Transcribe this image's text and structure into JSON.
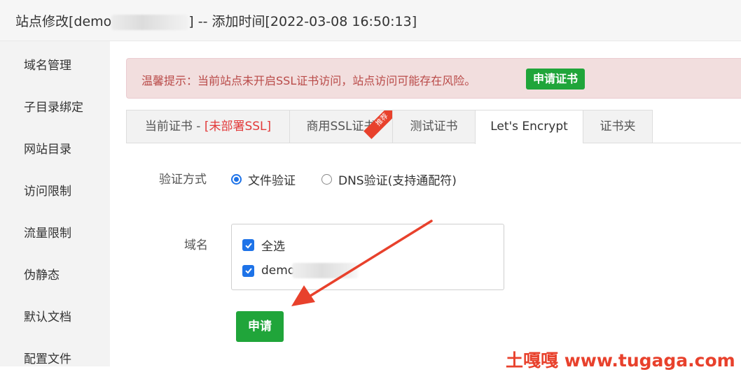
{
  "window": {
    "title_prefix": "站点修改[demo",
    "title_suffix": "] -- 添加时间[2022-03-08 16:50:13]"
  },
  "sidebar": {
    "items": [
      {
        "label": "域名管理"
      },
      {
        "label": "子目录绑定"
      },
      {
        "label": "网站目录"
      },
      {
        "label": "访问限制"
      },
      {
        "label": "流量限制"
      },
      {
        "label": "伪静态"
      },
      {
        "label": "默认文档"
      },
      {
        "label": "配置文件"
      }
    ]
  },
  "alert": {
    "message": "温馨提示：当前站点未开启SSL证书访问，站点访问可能存在风险。",
    "button_label": "申请证书"
  },
  "tabs": {
    "current_cert_label": "当前证书 - ",
    "current_cert_status": "[未部署SSL]",
    "commercial_label": "商用SSL证书",
    "commercial_badge": "推荐",
    "test_label": "测试证书",
    "letsencrypt_label": "Let's Encrypt",
    "folder_label": "证书夹",
    "active": "Let's Encrypt"
  },
  "form": {
    "verify_label": "验证方式",
    "verify_options": [
      {
        "label": "文件验证",
        "selected": true
      },
      {
        "label": "DNS验证(支持通配符)",
        "selected": false
      }
    ],
    "domain_label": "域名",
    "domains": [
      {
        "label": "全选",
        "checked": true
      },
      {
        "label": "demo",
        "checked": true
      }
    ],
    "apply_label": "申请"
  },
  "watermark": "土嘎嘎 www.tugaga.com",
  "colors": {
    "accent_green": "#20a53a",
    "alert_text": "#b94a48",
    "alert_bg": "#f2dede",
    "checkbox_blue": "#1e73e8",
    "arrow_red": "#e8412c"
  }
}
